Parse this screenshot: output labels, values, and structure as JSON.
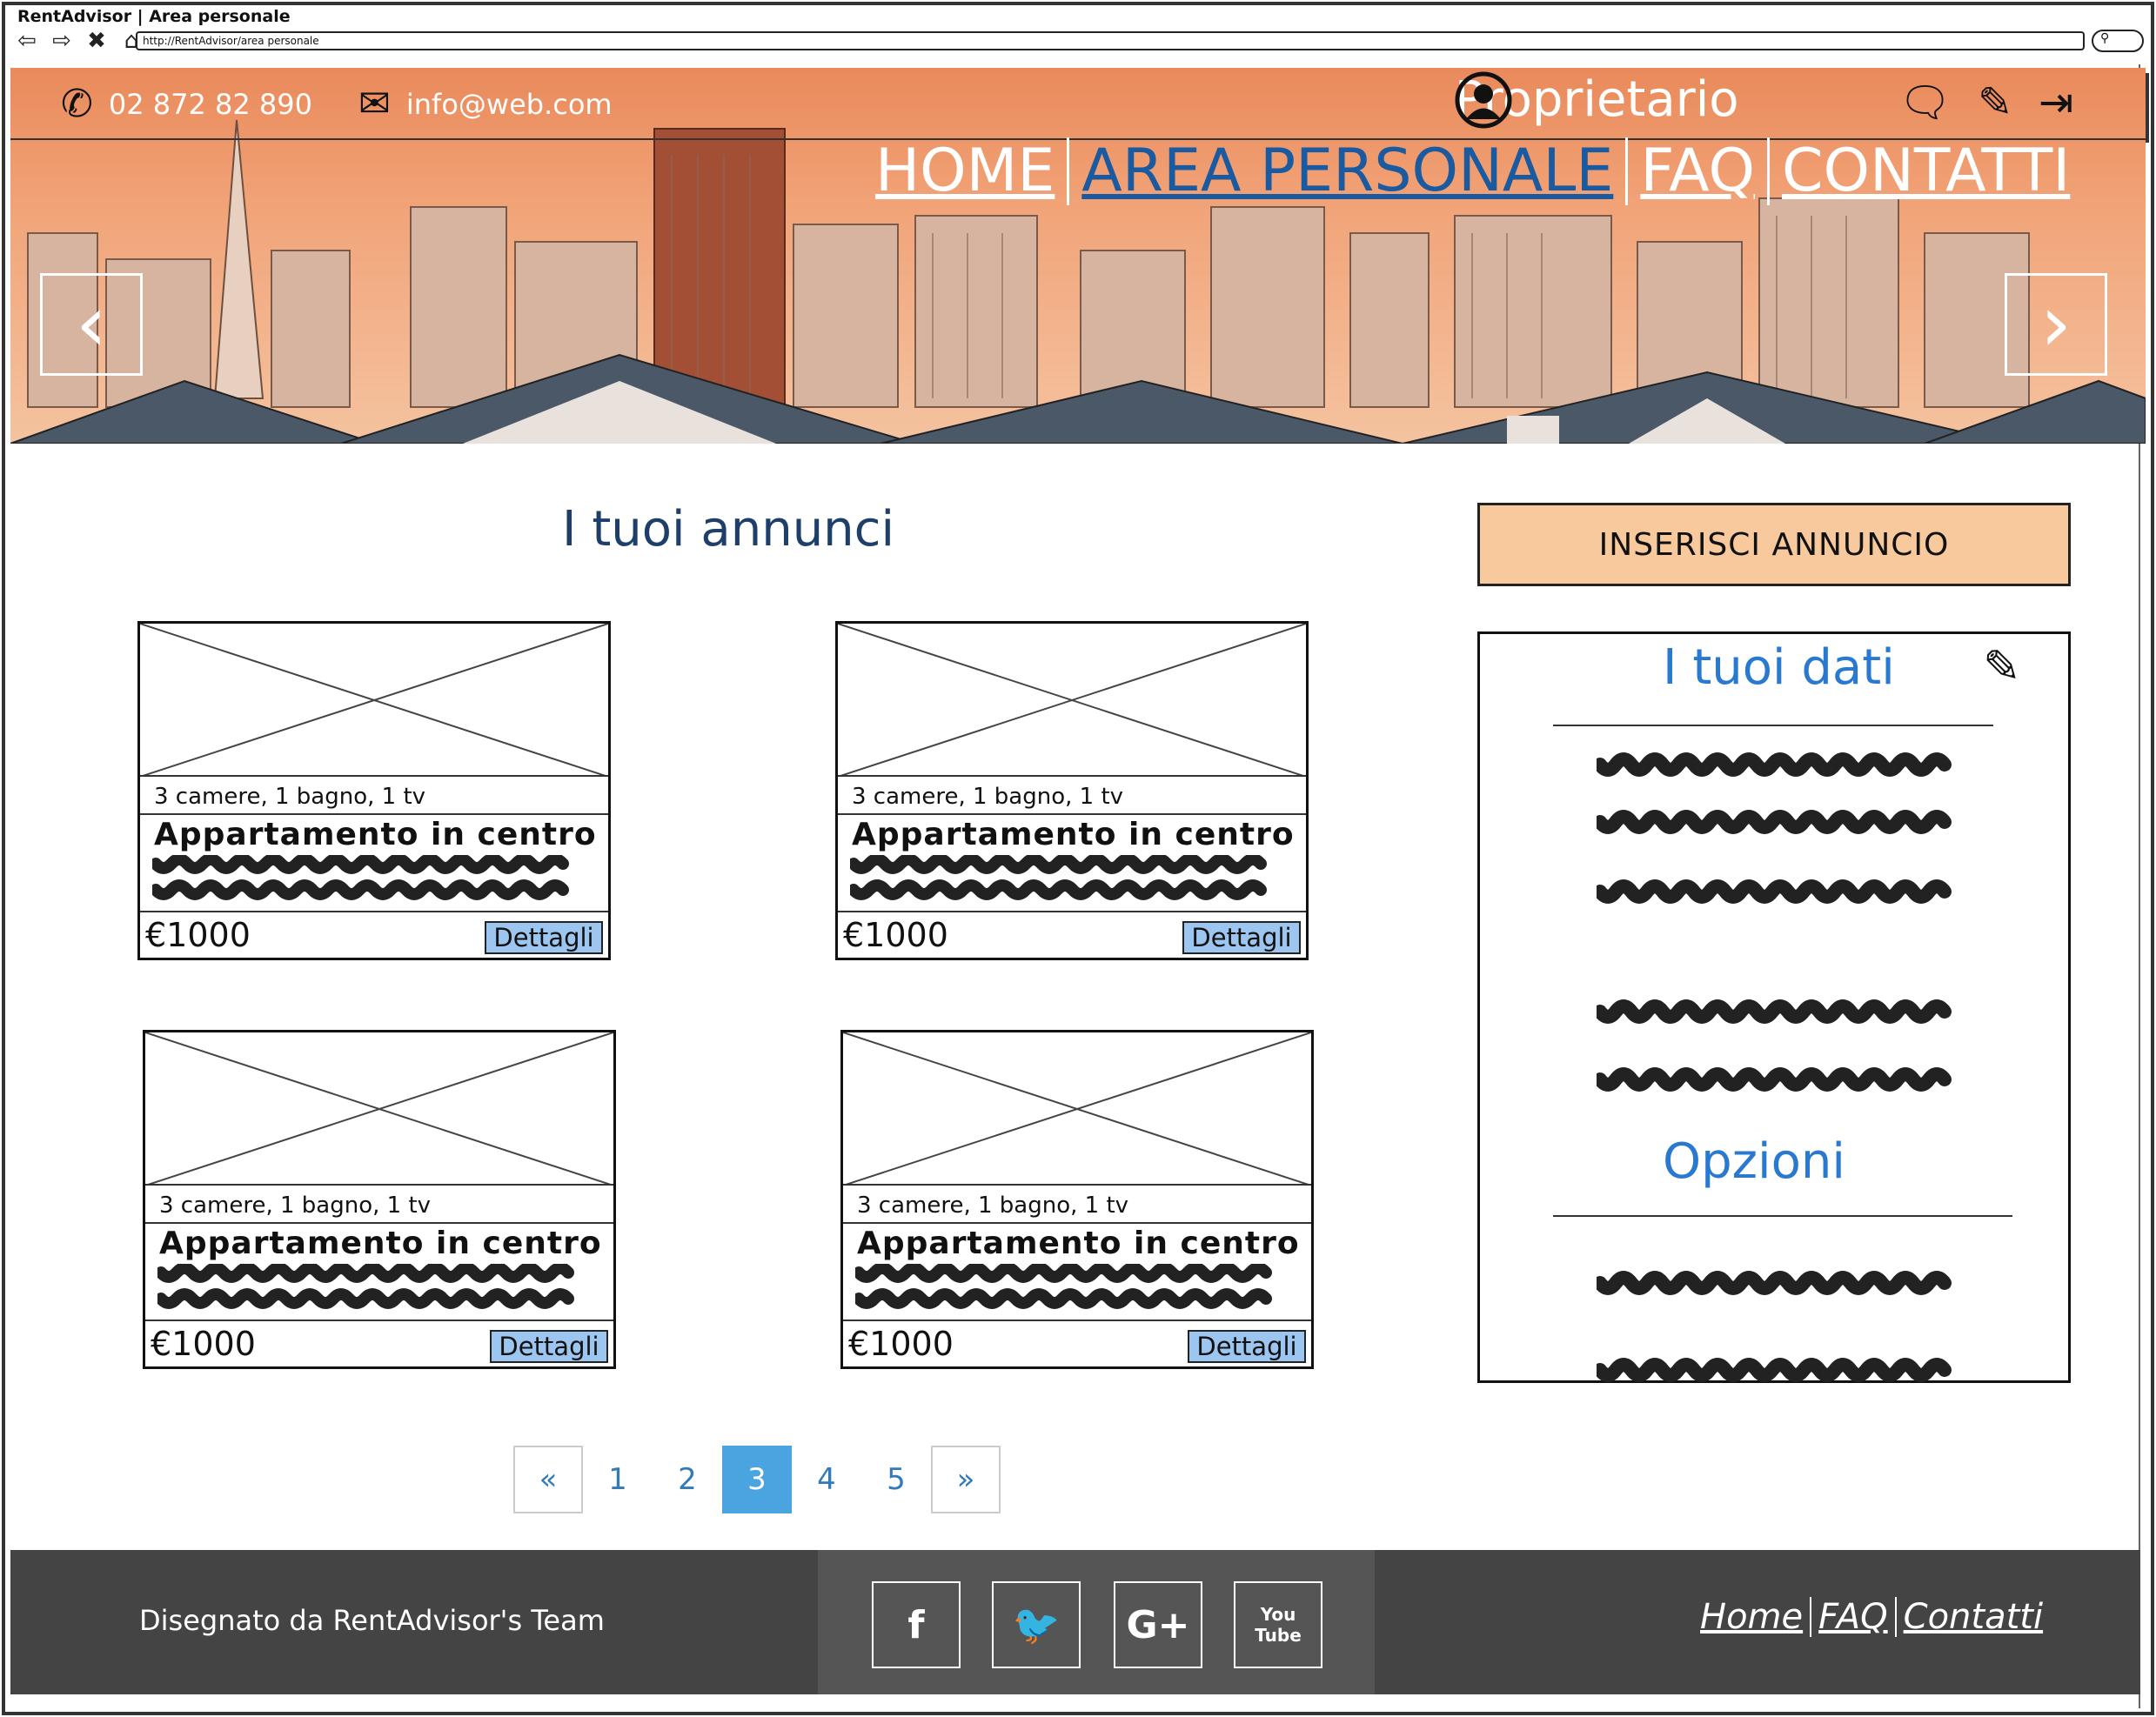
{
  "window": {
    "title": "RentAdvisor | Area personale",
    "url": "http://RentAdvisor/area personale"
  },
  "header": {
    "phone": "02 872 82 890",
    "email": "info@web.com",
    "user": "Proprietario",
    "menu": [
      "HOME",
      "AREA PERSONALE",
      "FAQ",
      "CONTATTI"
    ],
    "active_menu": "AREA PERSONALE"
  },
  "main": {
    "title": "I tuoi annunci",
    "listings": [
      {
        "meta": "3 camere, 1 bagno, 1 tv",
        "title": "Appartamento in centro",
        "price": "€1000",
        "button": "Dettagli"
      },
      {
        "meta": "3 camere, 1 bagno, 1 tv",
        "title": "Appartamento in centro",
        "price": "€1000",
        "button": "Dettagli"
      },
      {
        "meta": "3 camere, 1 bagno, 1 tv",
        "title": "Appartamento in centro",
        "price": "€1000",
        "button": "Dettagli"
      },
      {
        "meta": "3 camere, 1 bagno, 1 tv",
        "title": "Appartamento in centro",
        "price": "€1000",
        "button": "Dettagli"
      }
    ],
    "pagination": {
      "prev": "«",
      "pages": [
        "1",
        "2",
        "3",
        "4",
        "5"
      ],
      "current": "3",
      "next": "»"
    }
  },
  "sidebar": {
    "insert_button": "INSERISCI ANNUNCIO",
    "data_title": "I tuoi dati",
    "options_title": "Opzioni"
  },
  "footer": {
    "credit": "Disegnato da RentAdvisor's Team",
    "social": [
      "f",
      "t",
      "G+",
      "YouTube"
    ],
    "links": [
      "Home",
      "FAQ",
      "Contatti"
    ]
  },
  "colors": {
    "accent": "#2979d0",
    "button": "#9cc5ef",
    "insert": "#f7c99c",
    "footer": "#444444",
    "active_page": "#4aa4e0"
  }
}
